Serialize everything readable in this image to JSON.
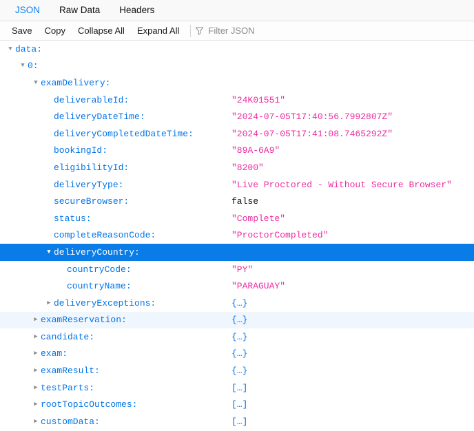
{
  "tabs": [
    {
      "label": "JSON",
      "active": true
    },
    {
      "label": "Raw Data",
      "active": false
    },
    {
      "label": "Headers",
      "active": false
    }
  ],
  "toolbar": {
    "save_label": "Save",
    "copy_label": "Copy",
    "collapse_all_label": "Collapse All",
    "expand_all_label": "Expand All",
    "filter_placeholder": "Filter JSON",
    "filter_value": "",
    "filter_icon": "funnel-icon"
  },
  "colors": {
    "key": "#0074e8",
    "string": "#ed2ba2",
    "boolean": "#12a33d",
    "selection_bg": "#0a7ce8",
    "alt_row_bg": "#f0f6fd",
    "tab_active": "#0a7ff0"
  },
  "tree": [
    {
      "depth": 0,
      "key": "data:",
      "twisty": "expanded",
      "value": "",
      "valueType": "none",
      "state": "normal"
    },
    {
      "depth": 1,
      "key": "0:",
      "twisty": "expanded",
      "value": "",
      "valueType": "none",
      "state": "normal"
    },
    {
      "depth": 2,
      "key": "examDelivery:",
      "twisty": "expanded",
      "value": "",
      "valueType": "none",
      "state": "normal"
    },
    {
      "depth": 3,
      "key": "deliverableId:",
      "twisty": "none",
      "value": "\"24K01551\"",
      "valueType": "string",
      "state": "normal"
    },
    {
      "depth": 3,
      "key": "deliveryDateTime:",
      "twisty": "none",
      "value": "\"2024-07-05T17:40:56.7992807Z\"",
      "valueType": "string",
      "state": "normal"
    },
    {
      "depth": 3,
      "key": "deliveryCompletedDateTime:",
      "twisty": "none",
      "value": "\"2024-07-05T17:41:08.7465292Z\"",
      "valueType": "string",
      "state": "normal"
    },
    {
      "depth": 3,
      "key": "bookingId:",
      "twisty": "none",
      "value": "\"89A-6A9\"",
      "valueType": "string",
      "state": "normal"
    },
    {
      "depth": 3,
      "key": "eligibilityId:",
      "twisty": "none",
      "value": "\"8200\"",
      "valueType": "string",
      "state": "normal"
    },
    {
      "depth": 3,
      "key": "deliveryType:",
      "twisty": "none",
      "value": "\"Live Proctored - Without Secure Browser\"",
      "valueType": "string",
      "state": "normal"
    },
    {
      "depth": 3,
      "key": "secureBrowser:",
      "twisty": "none",
      "value": "false",
      "valueType": "boolean",
      "state": "normal"
    },
    {
      "depth": 3,
      "key": "status:",
      "twisty": "none",
      "value": "\"Complete\"",
      "valueType": "string",
      "state": "normal"
    },
    {
      "depth": 3,
      "key": "completeReasonCode:",
      "twisty": "none",
      "value": "\"ProctorCompleted\"",
      "valueType": "string",
      "state": "normal"
    },
    {
      "depth": 3,
      "key": "deliveryCountry:",
      "twisty": "expanded",
      "value": "",
      "valueType": "none",
      "state": "selected"
    },
    {
      "depth": 4,
      "key": "countryCode:",
      "twisty": "none",
      "value": "\"PY\"",
      "valueType": "string",
      "state": "normal"
    },
    {
      "depth": 4,
      "key": "countryName:",
      "twisty": "none",
      "value": "\"PARAGUAY\"",
      "valueType": "string",
      "state": "normal"
    },
    {
      "depth": 3,
      "key": "deliveryExceptions:",
      "twisty": "collapsed",
      "value": "{…}",
      "valueType": "object",
      "state": "normal"
    },
    {
      "depth": 2,
      "key": "examReservation:",
      "twisty": "collapsed",
      "value": "{…}",
      "valueType": "object",
      "state": "alt"
    },
    {
      "depth": 2,
      "key": "candidate:",
      "twisty": "collapsed",
      "value": "{…}",
      "valueType": "object",
      "state": "normal"
    },
    {
      "depth": 2,
      "key": "exam:",
      "twisty": "collapsed",
      "value": "{…}",
      "valueType": "object",
      "state": "normal"
    },
    {
      "depth": 2,
      "key": "examResult:",
      "twisty": "collapsed",
      "value": "{…}",
      "valueType": "object",
      "state": "normal"
    },
    {
      "depth": 2,
      "key": "testParts:",
      "twisty": "collapsed",
      "value": "[…]",
      "valueType": "array",
      "state": "normal"
    },
    {
      "depth": 2,
      "key": "rootTopicOutcomes:",
      "twisty": "collapsed",
      "value": "[…]",
      "valueType": "array",
      "state": "normal"
    },
    {
      "depth": 2,
      "key": "customData:",
      "twisty": "collapsed",
      "value": "[…]",
      "valueType": "array",
      "state": "normal"
    }
  ]
}
